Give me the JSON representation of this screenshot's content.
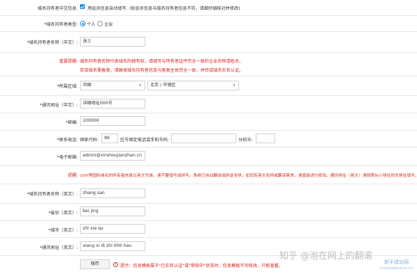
{
  "rows": {
    "chinese_info": {
      "label": "域名持有者中文信息:",
      "checkbox_label": "用会员信息自动填写",
      "hint": "(如会员信息与域名持有者信息不符，请细仔细核对并修改)"
    },
    "holder_type": {
      "label": "*域名持有者类型:",
      "options": [
        "个人",
        "企业"
      ],
      "selected": "个人"
    },
    "holder_name_cn": {
      "label": "*域名持有者名称（中文）:",
      "value": "张三"
    },
    "important_tip": {
      "label": "重要提醒:",
      "line1": "域名持有者名称代表域名的拥有权，请填写与所有者证件完全一致的企业名称或姓名。",
      "line2": "若该域名需备案，请确保域名持有者信息与备案主体完全一致，并尽成域名实名认证。"
    },
    "region": {
      "label": "*所属区域:",
      "country": "中国",
      "city": "北京 / 市辖区"
    },
    "address_cn": {
      "label": "*通讯地址（中文）:",
      "value": "详细地址000号"
    },
    "postcode": {
      "label": "*邮编:",
      "value": "100000"
    },
    "phone": {
      "label": "*联系电话:",
      "country_code_label": "国家代码:",
      "country_code": "86",
      "area_label": "区号固定电话或手机号码:",
      "area_value": "",
      "ext_label": "分机号:",
      "ext_value": ""
    },
    "email": {
      "label": "*电子邮箱:",
      "value": "admin@xinshoujianzhan.cn"
    },
    "tip": {
      "label": "提醒:",
      "text": "com等国际域名的所有者信息以英文为准，请不要填写成拼写。系统已自动翻译成拼音全拼，如您有英文名称或翻译需求，请直接进行修改。通讯地址（英文）请按照从小地址到大地址填写。"
    },
    "holder_name_en": {
      "label": "*域名持有者名称（英文）:",
      "value": "zhang san"
    },
    "province_en": {
      "label": "*省份（英文）:",
      "value": "bei jing"
    },
    "city_en": {
      "label": "*城市（英文）:",
      "value": "shi xia qu"
    },
    "address_en": {
      "label": "*通讯地址（英文）:",
      "value": "xiang xi di zhi 000 hao"
    }
  },
  "footer": {
    "save_label": "保存",
    "warning": "提示：信息模板属于\"已实名认证\"或\"审核中\"状态时，信息模板不可修改，只能查看。"
  },
  "watermark": {
    "zhihu": "知乎 @泡在网上的翻滚",
    "site": "新手建站网",
    "site_url": "xinshoujianzhan.cn"
  },
  "colors": {
    "accent": "#1f8fe6",
    "warning_red": "#d9261c"
  }
}
